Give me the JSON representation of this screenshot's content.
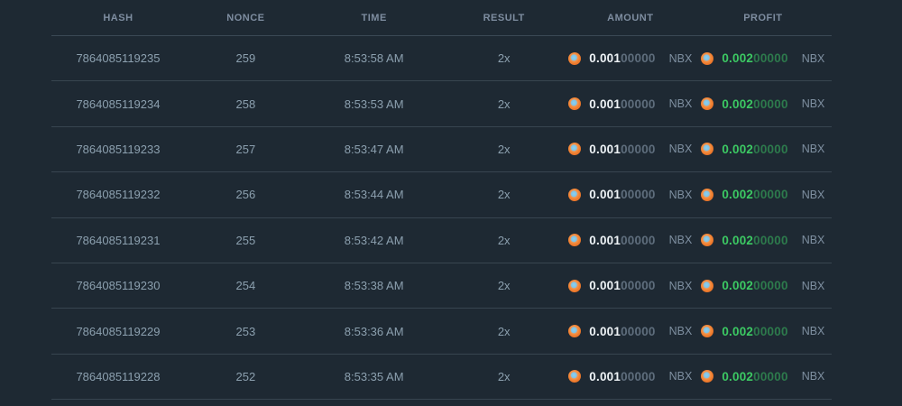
{
  "table": {
    "currency": "NBX",
    "columns": [
      {
        "key": "hash",
        "label": "HASH"
      },
      {
        "key": "nonce",
        "label": "NONCE"
      },
      {
        "key": "time",
        "label": "TIME"
      },
      {
        "key": "result",
        "label": "RESULT"
      },
      {
        "key": "amount",
        "label": "AMOUNT"
      },
      {
        "key": "profit",
        "label": "PROFIT"
      }
    ],
    "rows": [
      {
        "hash": "7864085119235",
        "nonce": "259",
        "time": "8:53:58 AM",
        "result": "2x",
        "amount_main": "0.001",
        "amount_zeros": "00000",
        "profit_main": "0.002",
        "profit_zeros": "00000"
      },
      {
        "hash": "7864085119234",
        "nonce": "258",
        "time": "8:53:53 AM",
        "result": "2x",
        "amount_main": "0.001",
        "amount_zeros": "00000",
        "profit_main": "0.002",
        "profit_zeros": "00000"
      },
      {
        "hash": "7864085119233",
        "nonce": "257",
        "time": "8:53:47 AM",
        "result": "2x",
        "amount_main": "0.001",
        "amount_zeros": "00000",
        "profit_main": "0.002",
        "profit_zeros": "00000"
      },
      {
        "hash": "7864085119232",
        "nonce": "256",
        "time": "8:53:44 AM",
        "result": "2x",
        "amount_main": "0.001",
        "amount_zeros": "00000",
        "profit_main": "0.002",
        "profit_zeros": "00000"
      },
      {
        "hash": "7864085119231",
        "nonce": "255",
        "time": "8:53:42 AM",
        "result": "2x",
        "amount_main": "0.001",
        "amount_zeros": "00000",
        "profit_main": "0.002",
        "profit_zeros": "00000"
      },
      {
        "hash": "7864085119230",
        "nonce": "254",
        "time": "8:53:38 AM",
        "result": "2x",
        "amount_main": "0.001",
        "amount_zeros": "00000",
        "profit_main": "0.002",
        "profit_zeros": "00000"
      },
      {
        "hash": "7864085119229",
        "nonce": "253",
        "time": "8:53:36 AM",
        "result": "2x",
        "amount_main": "0.001",
        "amount_zeros": "00000",
        "profit_main": "0.002",
        "profit_zeros": "00000"
      },
      {
        "hash": "7864085119228",
        "nonce": "252",
        "time": "8:53:35 AM",
        "result": "2x",
        "amount_main": "0.001",
        "amount_zeros": "00000",
        "profit_main": "0.002",
        "profit_zeros": "00000"
      }
    ]
  },
  "colors": {
    "background": "#1e2933",
    "header_text": "#7e8da0",
    "row_text": "#8ca0af",
    "divider": "#4a5a68",
    "amount_white": "#eef3f6",
    "amount_zeros_gray": "#5e6d7c",
    "profit_green": "#3cc963",
    "profit_zeros_green": "#2d7a4c",
    "coin_orange": "#ee7d2e",
    "coin_center_blue": "#7fc4e8",
    "currency_gray": "#7e8fa0"
  }
}
